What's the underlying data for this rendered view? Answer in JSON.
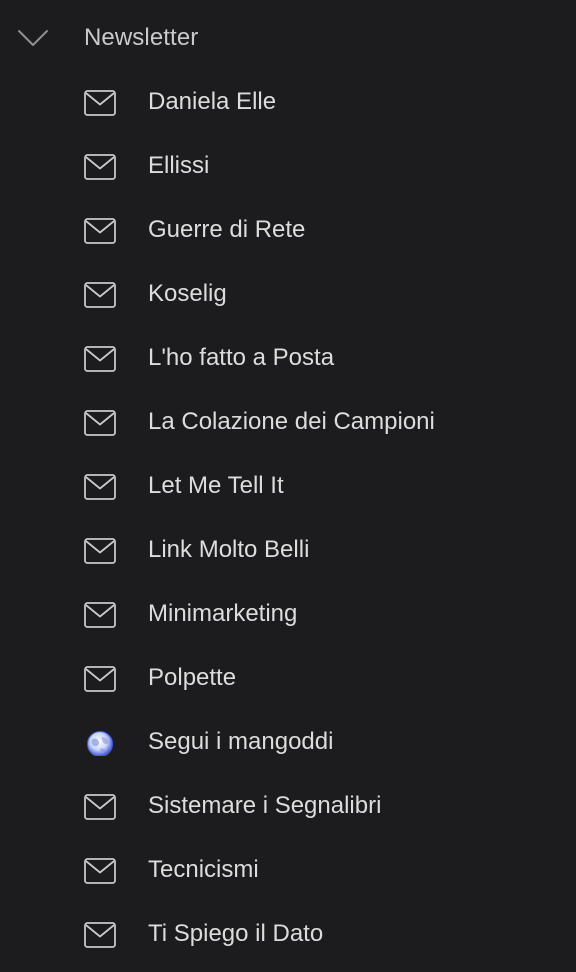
{
  "folder": {
    "title": "Newsletter",
    "expanded": true,
    "chevron_icon": "chevron-down-icon"
  },
  "feeds": [
    {
      "label": "Daniela Elle",
      "icon": "envelope-icon"
    },
    {
      "label": "Ellissi",
      "icon": "envelope-icon"
    },
    {
      "label": "Guerre di Rete",
      "icon": "envelope-icon"
    },
    {
      "label": "Koselig",
      "icon": "envelope-icon"
    },
    {
      "label": "L'ho fatto a Posta",
      "icon": "envelope-icon"
    },
    {
      "label": "La Colazione dei Campioni",
      "icon": "envelope-icon"
    },
    {
      "label": "Let Me Tell It",
      "icon": "envelope-icon"
    },
    {
      "label": "Link Molto Belli",
      "icon": "envelope-icon"
    },
    {
      "label": "Minimarketing",
      "icon": "envelope-icon"
    },
    {
      "label": "Polpette",
      "icon": "envelope-icon"
    },
    {
      "label": "Segui i mangoddi",
      "icon": "globe-icon"
    },
    {
      "label": "Sistemare i Segnalibri",
      "icon": "envelope-icon"
    },
    {
      "label": "Tecnicismi",
      "icon": "envelope-icon"
    },
    {
      "label": "Ti Spiego il Dato",
      "icon": "envelope-icon"
    }
  ],
  "colors": {
    "background": "#1c1c1e",
    "text": "#dcdcdc",
    "icon": "#c8c8ca"
  }
}
